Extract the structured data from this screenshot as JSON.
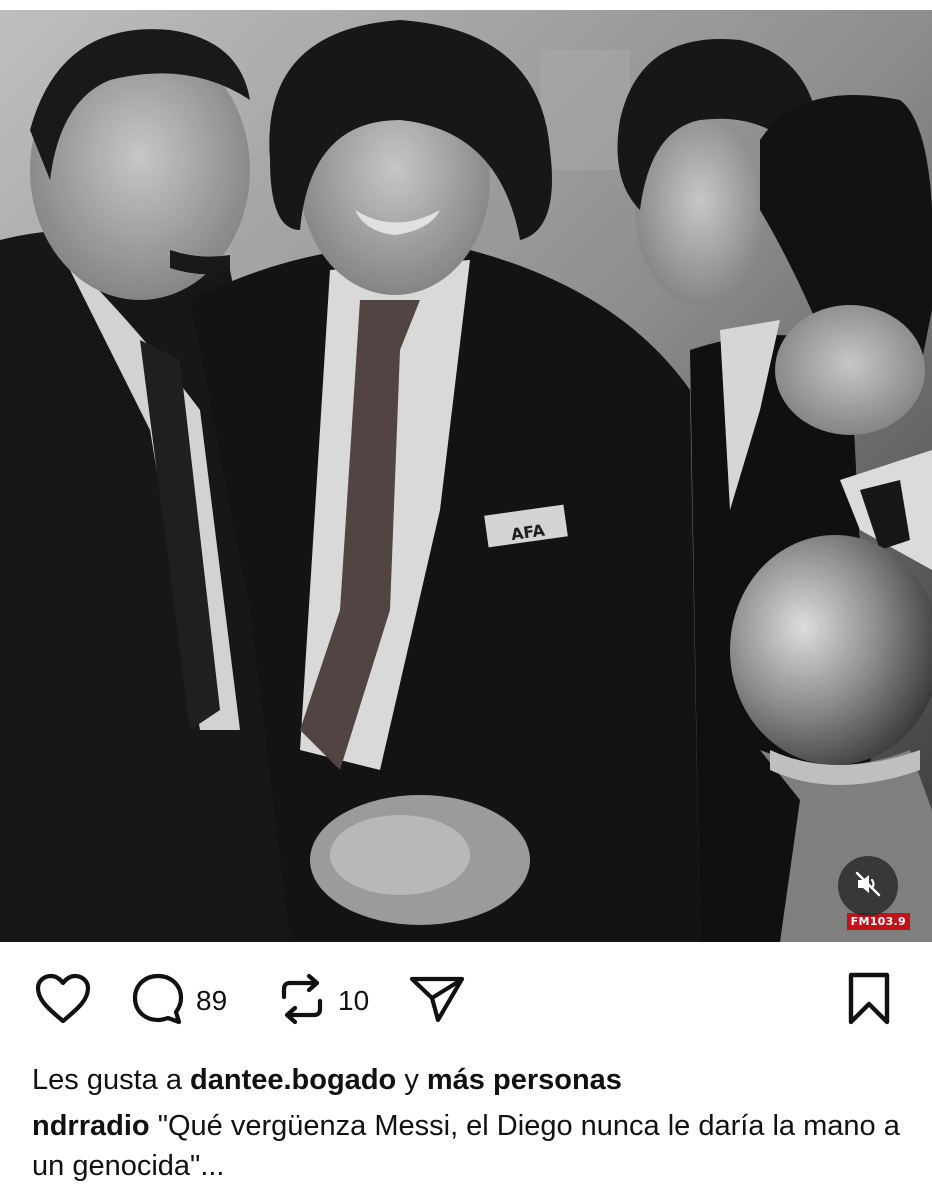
{
  "post": {
    "image_alt": "Black and white photo of men in suits shaking hands, one with an AFA badge, next to a silver trophy",
    "badge": "AFA",
    "watermark": "FM103.9"
  },
  "actions": {
    "like_icon": "heart-icon",
    "comment_icon": "comment-bubble-icon",
    "comment_count": "89",
    "repost_icon": "repost-icon",
    "repost_count": "10",
    "share_icon": "send-icon",
    "save_icon": "bookmark-icon",
    "mute_icon": "speaker-muted-icon"
  },
  "likes": {
    "prefix": "Les gusta a",
    "user": "dantee.bogado",
    "connector": "y",
    "others": "más personas"
  },
  "caption": {
    "username": "ndrradio",
    "text": "\"Qué vergüenza Messi, el Diego nunca le daría la mano a un genocida\"..."
  },
  "colors": {
    "text": "#111111",
    "background": "#ffffff",
    "watermark_red": "#c0121b"
  }
}
